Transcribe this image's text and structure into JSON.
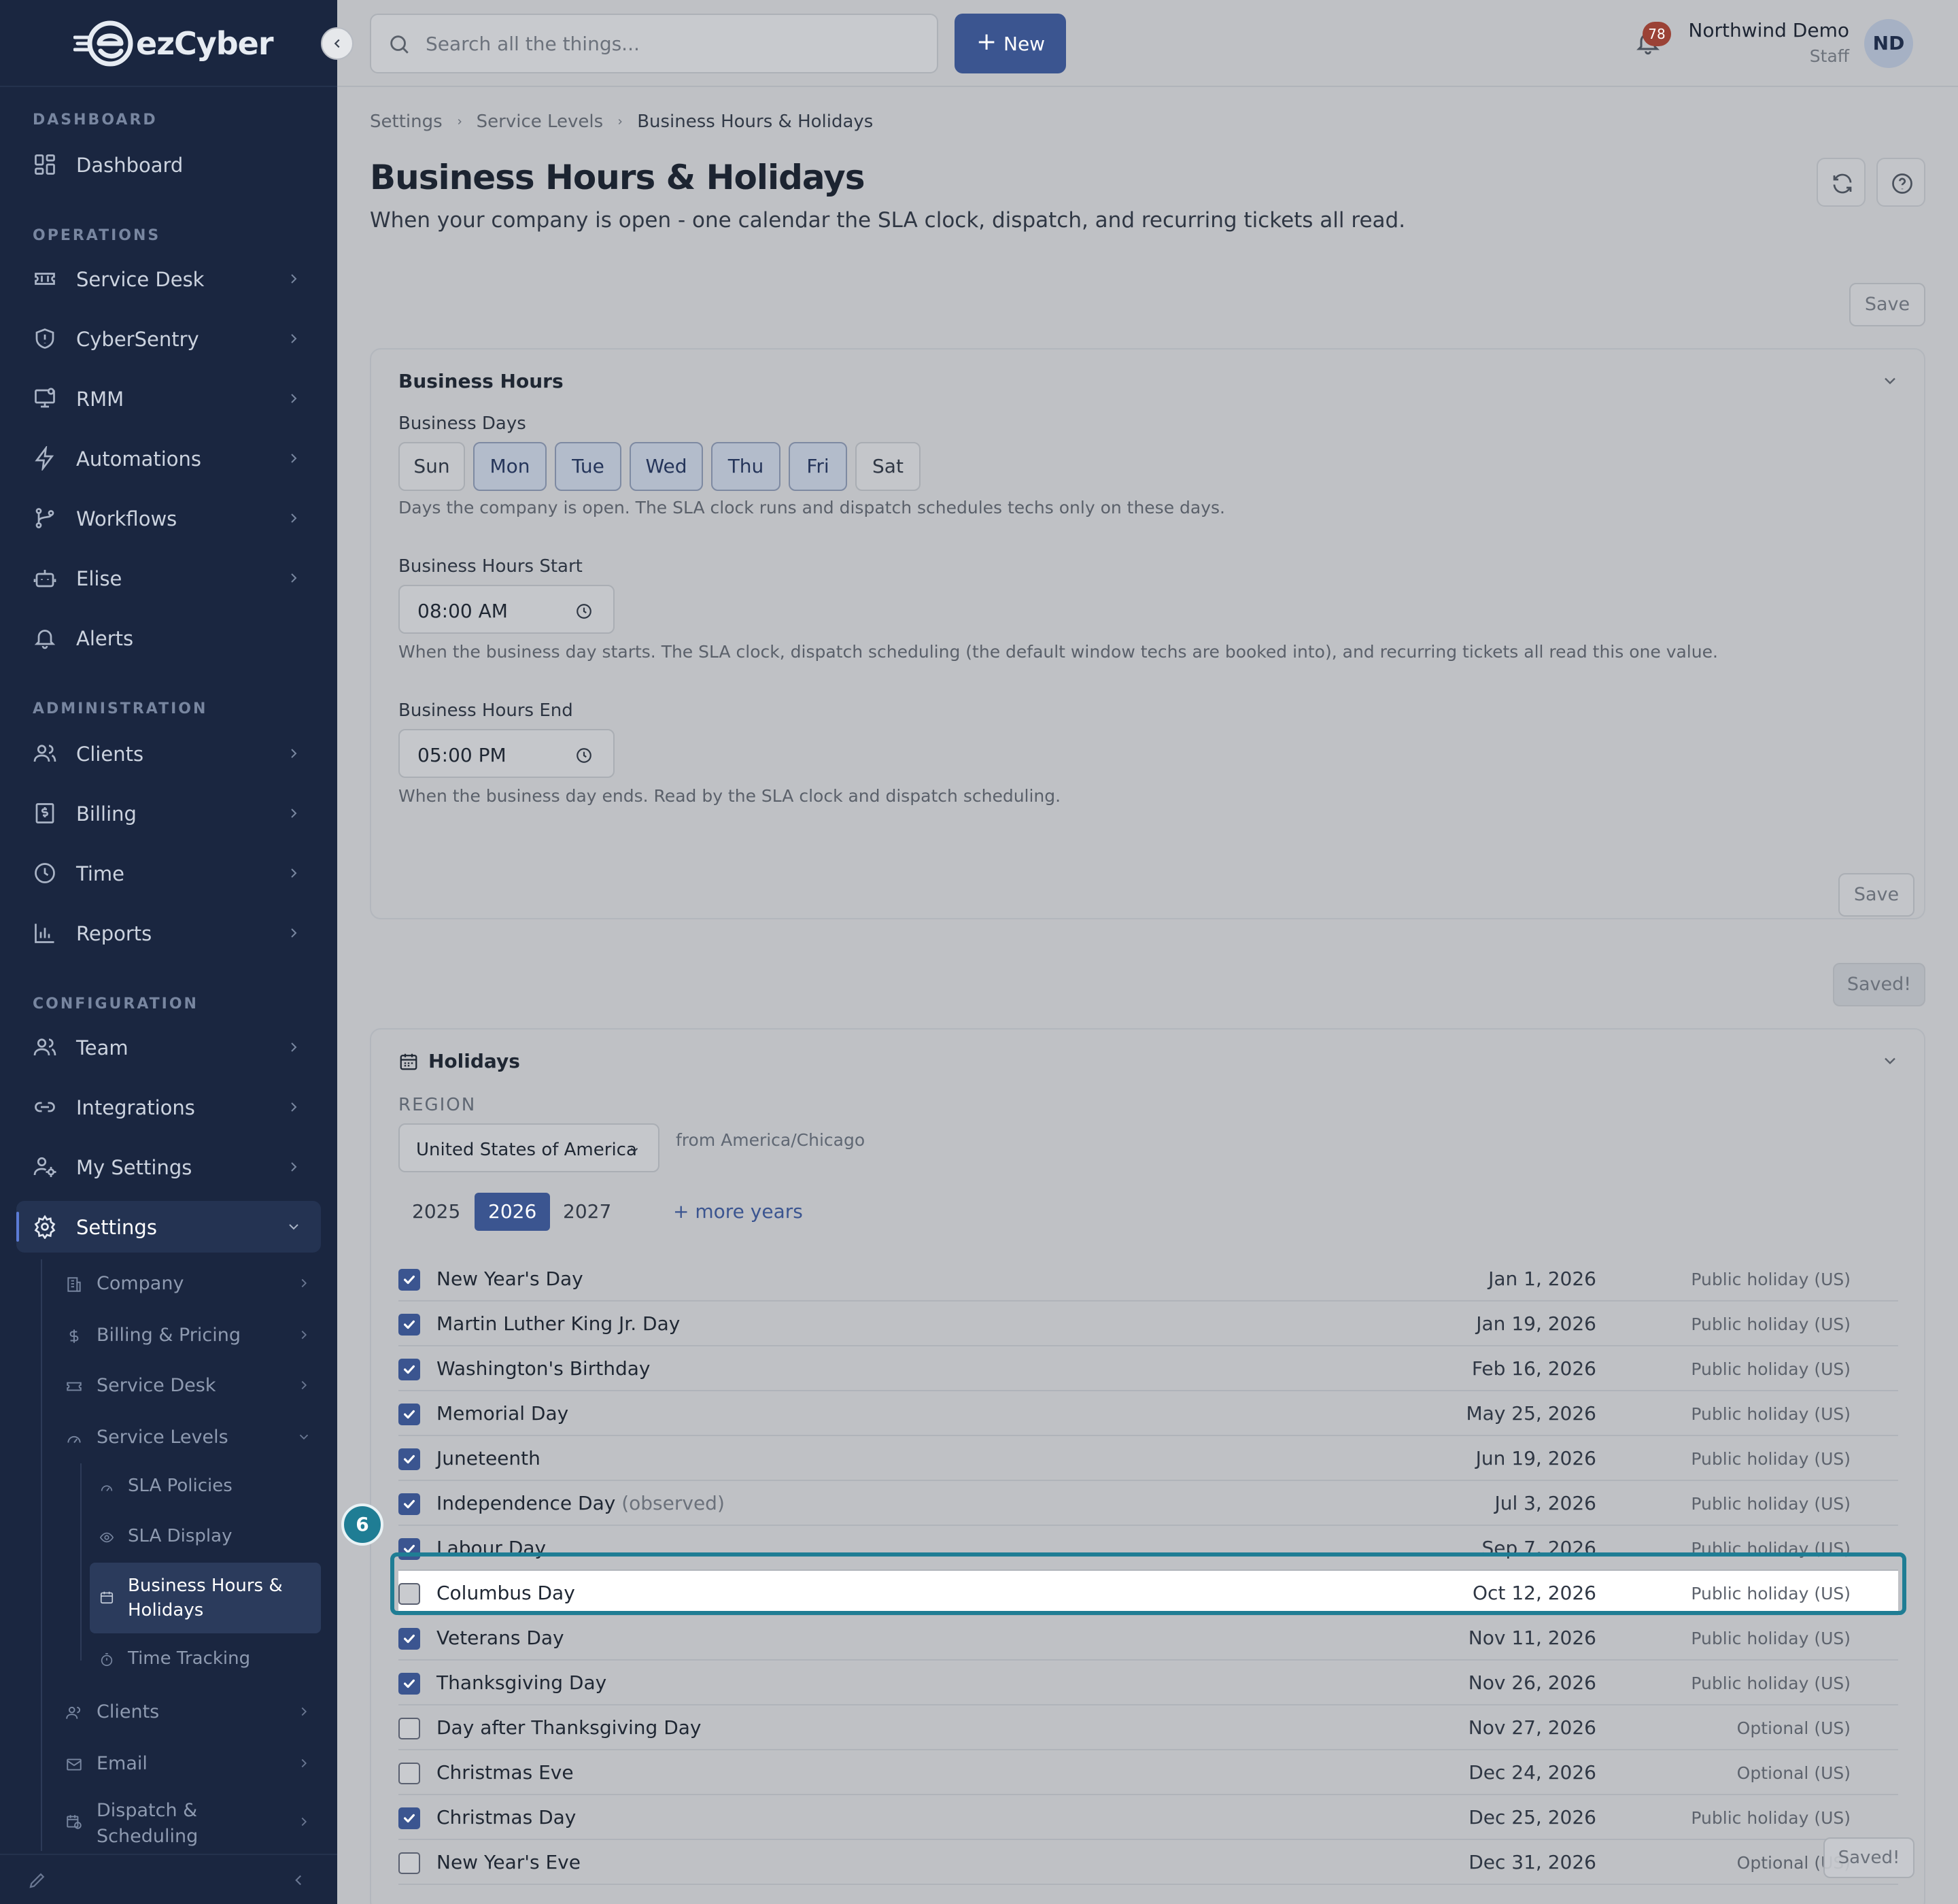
{
  "app": {
    "brand": "ezCyber",
    "accent": "#3b5590",
    "sidebar_bg": "#1a2640",
    "highlight": "#1f7d94"
  },
  "sidebar": {
    "sections": {
      "dashboard": "DASHBOARD",
      "operations": "OPERATIONS",
      "administration": "ADMINISTRATION",
      "configuration": "CONFIGURATION"
    },
    "items": {
      "dashboard": "Dashboard",
      "service_desk": "Service Desk",
      "cybersentry": "CyberSentry",
      "rmm": "RMM",
      "automations": "Automations",
      "workflows": "Workflows",
      "elise": "Elise",
      "alerts": "Alerts",
      "clients": "Clients",
      "billing": "Billing",
      "time": "Time",
      "reports": "Reports",
      "team": "Team",
      "integrations": "Integrations",
      "my_settings": "My Settings",
      "settings": "Settings"
    },
    "settings_sub": {
      "company": "Company",
      "billing_pricing": "Billing & Pricing",
      "service_desk": "Service Desk",
      "service_levels": "Service Levels",
      "clients": "Clients",
      "email": "Email",
      "dispatch_1": "Dispatch &",
      "dispatch_2": "Scheduling"
    },
    "service_levels_sub": {
      "sla_policies": "SLA Policies",
      "sla_display": "SLA Display",
      "bh_1": "Business Hours &",
      "bh_2": "Holidays",
      "time_tracking": "Time Tracking"
    }
  },
  "topbar": {
    "search_placeholder": "Search all the things...",
    "new_label": "New",
    "notifications": "78",
    "user_name": "Northwind Demo",
    "user_role": "Staff",
    "avatar": "ND"
  },
  "breadcrumb": [
    "Settings",
    "Service Levels",
    "Business Hours & Holidays"
  ],
  "page": {
    "title": "Business Hours & Holidays",
    "subtitle": "When your company is open - one calendar the SLA clock, dispatch, and recurring tickets all read.",
    "save": "Save",
    "saved": "Saved!"
  },
  "business_hours": {
    "title": "Business Hours",
    "days_label": "Business Days",
    "days": [
      {
        "label": "Sun",
        "on": false
      },
      {
        "label": "Mon",
        "on": true
      },
      {
        "label": "Tue",
        "on": true
      },
      {
        "label": "Wed",
        "on": true
      },
      {
        "label": "Thu",
        "on": true
      },
      {
        "label": "Fri",
        "on": true
      },
      {
        "label": "Sat",
        "on": false
      }
    ],
    "days_help": "Days the company is open. The SLA clock runs and dispatch schedules techs only on these days.",
    "start_label": "Business Hours Start",
    "start_value": "08:00 AM",
    "start_help": "When the business day starts. The SLA clock, dispatch scheduling (the default window techs are booked into), and recurring tickets all read this one value.",
    "end_label": "Business Hours End",
    "end_value": "05:00 PM",
    "end_help": "When the business day ends. Read by the SLA clock and dispatch scheduling."
  },
  "holidays": {
    "title": "Holidays",
    "region_label": "REGION",
    "region_value": "United States of America",
    "timezone_note": "from America/Chicago",
    "years": [
      "2025",
      "2026",
      "2027"
    ],
    "selected_year": "2026",
    "more_years": "+ more years",
    "rows": [
      {
        "name": "New Year's Day",
        "suffix": "",
        "date": "Jan 1, 2026",
        "type": "Public holiday (US)",
        "checked": true
      },
      {
        "name": "Martin Luther King Jr. Day",
        "suffix": "",
        "date": "Jan 19, 2026",
        "type": "Public holiday (US)",
        "checked": true
      },
      {
        "name": "Washington's Birthday",
        "suffix": "",
        "date": "Feb 16, 2026",
        "type": "Public holiday (US)",
        "checked": true
      },
      {
        "name": "Memorial Day",
        "suffix": "",
        "date": "May 25, 2026",
        "type": "Public holiday (US)",
        "checked": true
      },
      {
        "name": "Juneteenth",
        "suffix": "",
        "date": "Jun 19, 2026",
        "type": "Public holiday (US)",
        "checked": true
      },
      {
        "name": "Independence Day",
        "suffix": "(observed)",
        "date": "Jul 3, 2026",
        "type": "Public holiday (US)",
        "checked": true
      },
      {
        "name": "Labour Day",
        "suffix": "",
        "date": "Sep 7, 2026",
        "type": "Public holiday (US)",
        "checked": true
      },
      {
        "name": "Columbus Day",
        "suffix": "",
        "date": "Oct 12, 2026",
        "type": "Public holiday (US)",
        "checked": false
      },
      {
        "name": "Veterans Day",
        "suffix": "",
        "date": "Nov 11, 2026",
        "type": "Public holiday (US)",
        "checked": true
      },
      {
        "name": "Thanksgiving Day",
        "suffix": "",
        "date": "Nov 26, 2026",
        "type": "Public holiday (US)",
        "checked": true
      },
      {
        "name": "Day after Thanksgiving Day",
        "suffix": "",
        "date": "Nov 27, 2026",
        "type": "Optional (US)",
        "checked": false
      },
      {
        "name": "Christmas Eve",
        "suffix": "",
        "date": "Dec 24, 2026",
        "type": "Optional (US)",
        "checked": false
      },
      {
        "name": "Christmas Day",
        "suffix": "",
        "date": "Dec 25, 2026",
        "type": "Public holiday (US)",
        "checked": true
      },
      {
        "name": "New Year's Eve",
        "suffix": "",
        "date": "Dec 31, 2026",
        "type": "Optional (US)",
        "checked": false
      }
    ]
  },
  "step_marker": "6"
}
